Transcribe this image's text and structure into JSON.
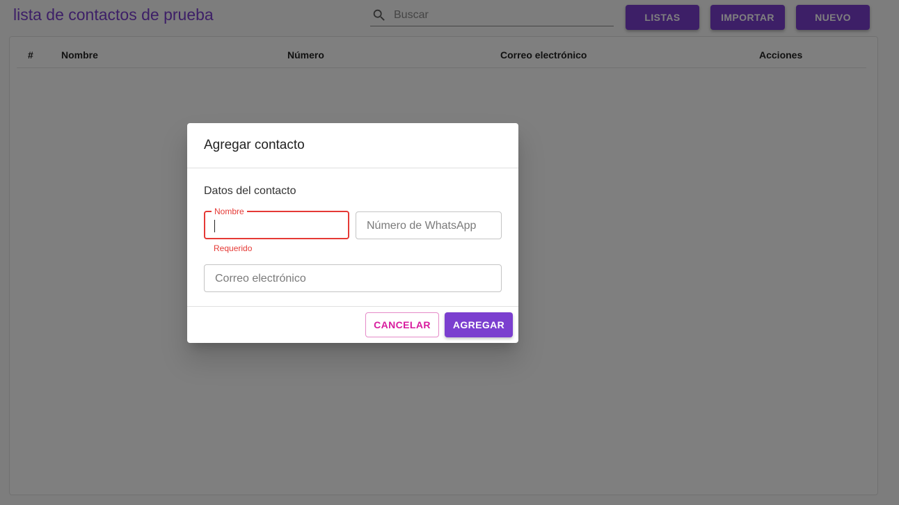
{
  "header": {
    "title": "lista de contactos de prueba",
    "search_placeholder": "Buscar",
    "buttons": {
      "lists": "LISTAS",
      "import": "IMPORTAR",
      "new": "NUEVO"
    }
  },
  "table": {
    "columns": [
      "#",
      "Nombre",
      "Número",
      "Correo electrónico",
      "Acciones"
    ],
    "rows": []
  },
  "dialog": {
    "title": "Agregar contacto",
    "section_label": "Datos del contacto",
    "name_field": {
      "label": "Nombre",
      "value": "",
      "helper": "Requerido"
    },
    "whatsapp_field": {
      "placeholder": "Número de WhatsApp",
      "value": ""
    },
    "email_field": {
      "placeholder": "Correo electrónico",
      "value": ""
    },
    "cancel_label": "CANCELAR",
    "add_label": "AGREGAR"
  },
  "colors": {
    "primary": "#7b3fcf",
    "secondary": "#d81b9e",
    "error": "#e53935"
  },
  "icons": {
    "search": "search-icon"
  }
}
